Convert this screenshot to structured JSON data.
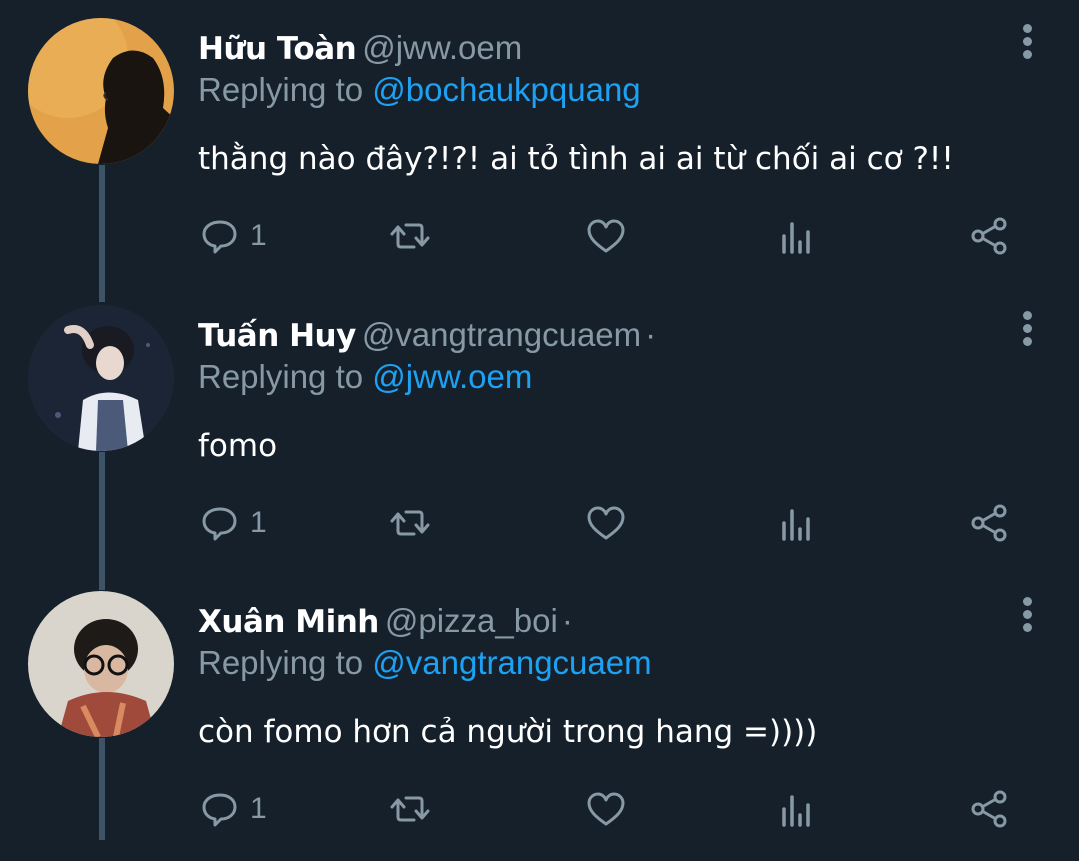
{
  "tweets": [
    {
      "name": "Hữu Toàn",
      "handle": "@jww.oem",
      "reply_label": "Replying to",
      "reply_to": "@bochaukpquang",
      "text": "thằng nào đây?!?! ai tỏ tình ai ai từ chối ai cơ ?!!",
      "reply_count": "1",
      "avatar_color": "#e0a040"
    },
    {
      "name": "Tuấn Huy",
      "handle": "@vangtrangcuaem",
      "dot": "·",
      "reply_label": "Replying to",
      "reply_to": "@jww.oem",
      "text": "fomo",
      "reply_count": "1",
      "avatar_color": "#1e2a3c"
    },
    {
      "name": "Xuân Minh",
      "handle": "@pizza_boi",
      "dot": "·",
      "reply_label": "Replying to",
      "reply_to": "@vangtrangcuaem",
      "text": "còn fomo hơn cả người trong hang =))))",
      "reply_count": "1",
      "avatar_color": "#d8d4cc"
    }
  ],
  "icons": [
    "reply-icon",
    "retweet-icon",
    "like-icon",
    "analytics-icon",
    "share-icon",
    "more-icon"
  ],
  "colors": {
    "background": "#15202b",
    "secondary_text": "#8899a6",
    "mention": "#1da1f2",
    "thread_line": "#3d5466"
  }
}
